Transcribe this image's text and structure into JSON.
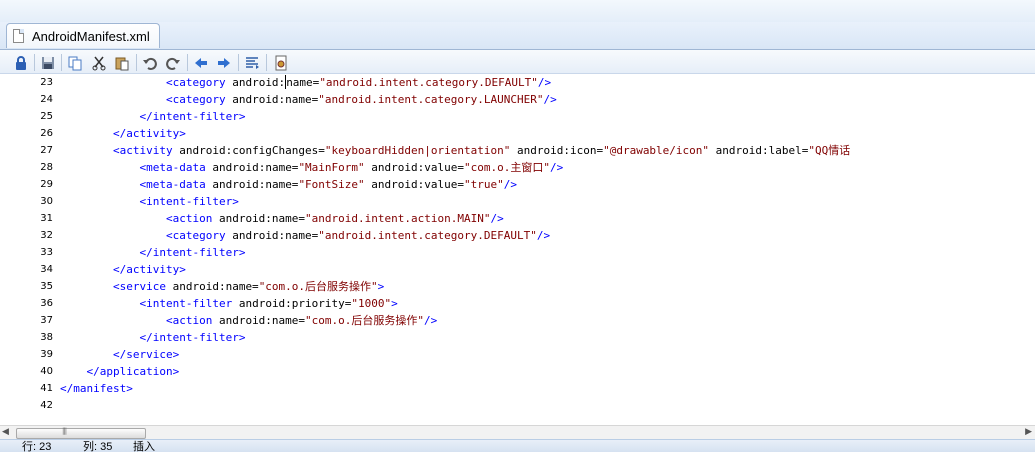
{
  "tab": {
    "title": "AndroidManifest.xml"
  },
  "toolbar": {
    "items": [
      "lock-icon",
      "save-icon",
      "copy-icon",
      "cut-icon",
      "paste-icon",
      "undo-icon",
      "redo-icon",
      "back-icon",
      "forward-icon",
      "format-icon",
      "settings-icon"
    ]
  },
  "editor": {
    "lines": [
      {
        "n": "23",
        "html": "                <span class='tag'>&lt;category</span> android:<span class='caret'></span>name=<span class='str'>\"android.intent.category.DEFAULT\"</span><span class='tag'>/&gt;</span>"
      },
      {
        "n": "24",
        "html": "                <span class='tag'>&lt;category</span> android:name=<span class='str'>\"android.intent.category.LAUNCHER\"</span><span class='tag'>/&gt;</span>"
      },
      {
        "n": "25",
        "html": "            <span class='tag'>&lt;/intent-filter&gt;</span>"
      },
      {
        "n": "26",
        "html": "        <span class='tag'>&lt;/activity&gt;</span>"
      },
      {
        "n": "27",
        "html": "        <span class='tag'>&lt;activity</span> android:configChanges=<span class='str'>\"keyboardHidden|orientation\"</span> android:icon=<span class='str'>\"@drawable/icon\"</span> android:label=<span class='str'>\"QQ情话</span>"
      },
      {
        "n": "28",
        "html": "            <span class='tag'>&lt;meta-data</span> android:name=<span class='str'>\"MainForm\"</span> android:value=<span class='str'>\"com.o.主窗口\"</span><span class='tag'>/&gt;</span>"
      },
      {
        "n": "29",
        "html": "            <span class='tag'>&lt;meta-data</span> android:name=<span class='str'>\"FontSize\"</span> android:value=<span class='str'>\"true\"</span><span class='tag'>/&gt;</span>"
      },
      {
        "n": "30",
        "html": "            <span class='tag'>&lt;intent-filter&gt;</span>"
      },
      {
        "n": "31",
        "html": "                <span class='tag'>&lt;action</span> android:name=<span class='str'>\"android.intent.action.MAIN\"</span><span class='tag'>/&gt;</span>"
      },
      {
        "n": "32",
        "html": "                <span class='tag'>&lt;category</span> android:name=<span class='str'>\"android.intent.category.DEFAULT\"</span><span class='tag'>/&gt;</span>"
      },
      {
        "n": "33",
        "html": "            <span class='tag'>&lt;/intent-filter&gt;</span>"
      },
      {
        "n": "34",
        "html": "        <span class='tag'>&lt;/activity&gt;</span>"
      },
      {
        "n": "35",
        "html": "        <span class='tag'>&lt;service</span> android:name=<span class='str'>\"com.o.后台服务操作\"</span><span class='tag'>&gt;</span>"
      },
      {
        "n": "36",
        "html": "            <span class='tag'>&lt;intent-filter</span> android:priority=<span class='str'>\"1000\"</span><span class='tag'>&gt;</span>"
      },
      {
        "n": "37",
        "html": "                <span class='tag'>&lt;action</span> android:name=<span class='str'>\"com.o.后台服务操作\"</span><span class='tag'>/&gt;</span>"
      },
      {
        "n": "38",
        "html": "            <span class='tag'>&lt;/intent-filter&gt;</span>"
      },
      {
        "n": "39",
        "html": "        <span class='tag'>&lt;/service&gt;</span>"
      },
      {
        "n": "40",
        "html": "    <span class='tag'>&lt;/application&gt;</span>"
      },
      {
        "n": "41",
        "html": "<span class='tag'>&lt;/manifest&gt;</span>"
      },
      {
        "n": "42",
        "html": ""
      }
    ]
  },
  "status": {
    "row": "行: 23",
    "col": "列: 35",
    "mode": "插入"
  }
}
